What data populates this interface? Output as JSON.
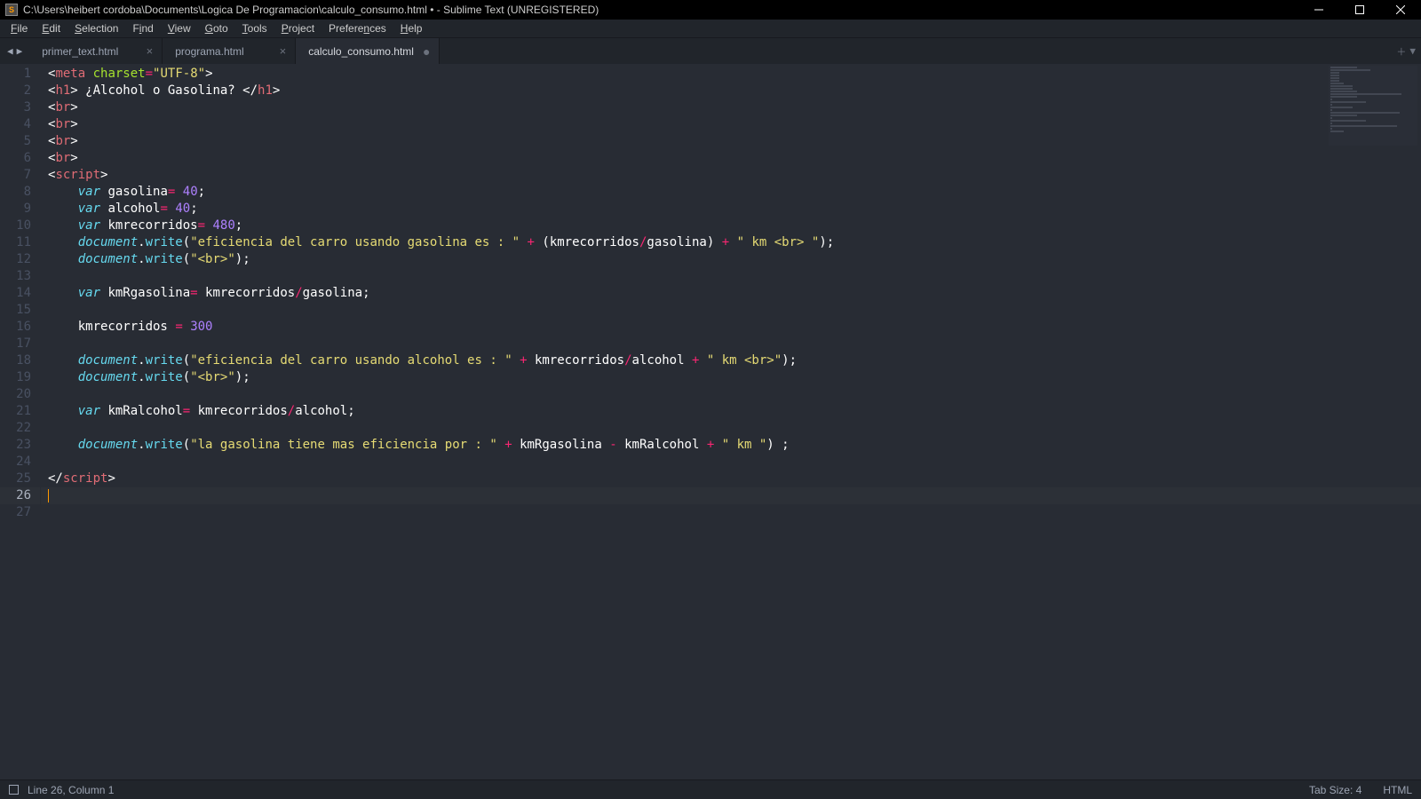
{
  "window": {
    "title": "C:\\Users\\heibert cordoba\\Documents\\Logica De Programacion\\calculo_consumo.html • - Sublime Text (UNREGISTERED)"
  },
  "menu": {
    "file": "File",
    "edit": "Edit",
    "selection": "Selection",
    "find": "Find",
    "view": "View",
    "goto": "Goto",
    "tools": "Tools",
    "project": "Project",
    "preferences": "Preferences",
    "help": "Help"
  },
  "tabs": [
    {
      "label": "primer_text.html",
      "active": false,
      "dirty": false
    },
    {
      "label": "programa.html",
      "active": false,
      "dirty": false
    },
    {
      "label": "calculo_consumo.html",
      "active": true,
      "dirty": true
    }
  ],
  "status": {
    "cursor": "Line 26, Column 1",
    "tabsize": "Tab Size: 4",
    "syntax": "HTML"
  },
  "code": {
    "line_count": 27,
    "active_line": 26,
    "lines_plain": [
      "<meta charset=\"UTF-8\">",
      "<h1> ¿Alcohol o Gasolina? </h1>",
      "<br>",
      "<br>",
      "<br>",
      "<br>",
      "<script>",
      "    var gasolina= 40;",
      "    var alcohol= 40;",
      "    var kmrecorridos= 480;",
      "    document.write(\"eficiencia del carro usando gasolina es : \" + (kmrecorridos/gasolina) + \" km <br> \");",
      "    document.write(\"<br>\");",
      "",
      "    var kmRgasolina= kmrecorridos/gasolina;",
      "",
      "    kmrecorridos = 300",
      "",
      "    document.write(\"eficiencia del carro usando alcohol es : \" + kmrecorridos/alcohol + \" km <br>\");",
      "    document.write(\"<br>\");",
      "",
      "    var kmRalcohol= kmrecorridos/alcohol;",
      "",
      "    document.write(\"la gasolina tiene mas eficiencia por : \" + kmRgasolina - kmRalcohol + \" km \") ;",
      "",
      "</script>",
      "",
      ""
    ]
  }
}
